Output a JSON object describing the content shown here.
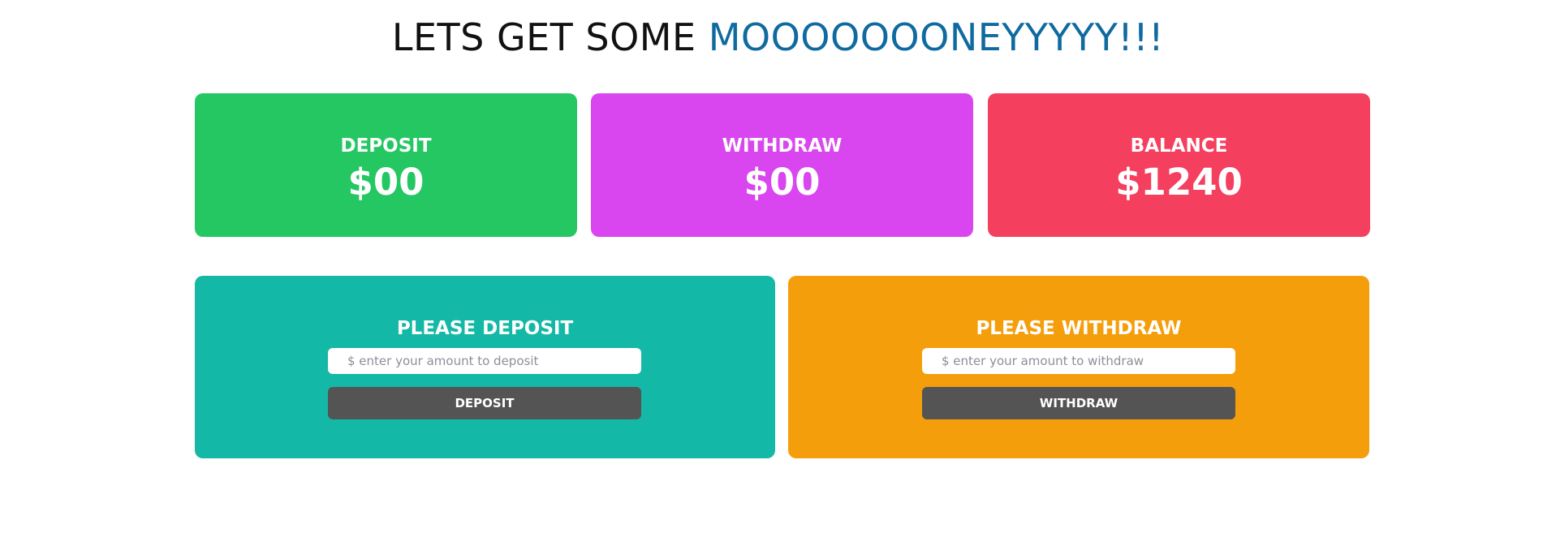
{
  "header": {
    "title_prefix": "LETS GET SOME ",
    "title_accent": "MOOOOOOONEYYYYY!!!",
    "accent_color": "#0f6aa0"
  },
  "stats": {
    "deposit": {
      "label": "DEPOSIT",
      "value": "$00",
      "color": "#25c763"
    },
    "withdraw": {
      "label": "WITHDRAW",
      "value": "$00",
      "color": "#d946ef"
    },
    "balance": {
      "label": "BALANCE",
      "value": "$1240",
      "color": "#f43f5e"
    }
  },
  "forms": {
    "deposit": {
      "title": "PLEASE DEPOSIT",
      "placeholder": "$ enter your amount to deposit",
      "value": "",
      "button_label": "DEPOSIT",
      "color": "#14b8a6"
    },
    "withdraw": {
      "title": "PLEASE WITHDRAW",
      "placeholder": "$ enter your amount to withdraw",
      "value": "",
      "button_label": "WITHDRAW",
      "color": "#f59e0b"
    }
  },
  "button_color": "#545454"
}
